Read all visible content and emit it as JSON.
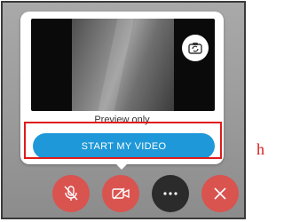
{
  "preview": {
    "caption": "Preview only",
    "switch_camera_icon": "camera-switch-icon"
  },
  "start_video": {
    "label": "START MY VIDEO",
    "color": "#1e98d8"
  },
  "highlight": {
    "color": "#e01b1b"
  },
  "controls": {
    "mute_icon": "microphone-muted-icon",
    "video_icon": "video-off-icon",
    "more_icon": "ellipsis-icon",
    "end_icon": "close-icon",
    "button_color": "#d9534f",
    "more_button_color": "#2b2b2b"
  },
  "side_text": "h"
}
